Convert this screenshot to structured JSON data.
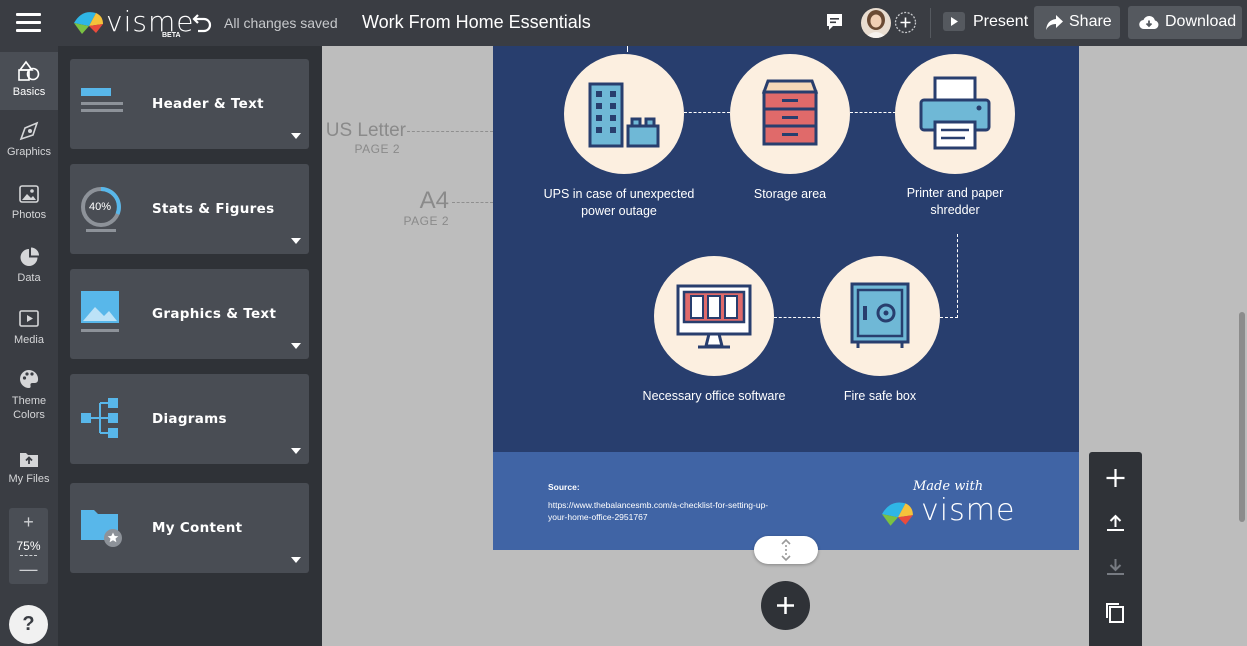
{
  "topbar": {
    "logo_text": "visme",
    "logo_badge": "BETA",
    "save_status": "All changes saved",
    "doc_title": "Work From Home Essentials",
    "present_label": "Present",
    "share_label": "Share",
    "download_label": "Download",
    "icons": [
      "menu-icon",
      "undo-icon",
      "comment-icon",
      "add-collaborator-icon",
      "play-icon",
      "share-icon",
      "cloud-download-icon"
    ]
  },
  "leftnav": {
    "items": [
      {
        "label": "Basics",
        "icon": "shapes-icon"
      },
      {
        "label": "Graphics",
        "icon": "graphics-icon"
      },
      {
        "label": "Photos",
        "icon": "photo-icon"
      },
      {
        "label": "Data",
        "icon": "pie-chart-icon"
      },
      {
        "label": "Media",
        "icon": "media-icon"
      },
      {
        "label": "Theme Colors",
        "icon": "palette-icon"
      },
      {
        "label": "My Files",
        "icon": "upload-icon"
      }
    ],
    "zoom": "75%",
    "help": "?"
  },
  "panel": {
    "cards": [
      {
        "label": "Header & Text"
      },
      {
        "label": "Stats & Figures",
        "badge": "40%"
      },
      {
        "label": "Graphics & Text"
      },
      {
        "label": "Diagrams"
      },
      {
        "label": "My Content"
      }
    ]
  },
  "page_labels": [
    {
      "name": "US Letter",
      "sub": "PAGE 2"
    },
    {
      "name": "A4",
      "sub": "PAGE 2"
    }
  ],
  "slide": {
    "items": [
      {
        "caption": "UPS in case of unexpected power outage",
        "icon": "building-icon"
      },
      {
        "caption": "Storage area",
        "icon": "cabinet-icon"
      },
      {
        "caption": "Printer and paper shredder",
        "icon": "printer-icon"
      },
      {
        "caption": "Necessary office software",
        "icon": "monitor-icon"
      },
      {
        "caption": "Fire safe box",
        "icon": "safe-icon"
      }
    ],
    "colors": {
      "background": "#283e6e",
      "circle": "#fcefe0",
      "footer": "#4064a5"
    }
  },
  "footer": {
    "source_title": "Source:",
    "source_url": "https://www.thebalancesmb.com/a-checklist-for-setting-up-your-home-office-2951767",
    "made_with": "Made with",
    "logo_text": "visme"
  },
  "right_toolbar": {
    "icons": [
      "add-block-icon",
      "move-block-up-icon",
      "move-block-down-icon",
      "duplicate-block-icon"
    ]
  },
  "colors": {
    "topbar": "#3a3d43",
    "panel": "#2f3237",
    "card": "#494d54",
    "canvas": "#bdbdbd"
  }
}
